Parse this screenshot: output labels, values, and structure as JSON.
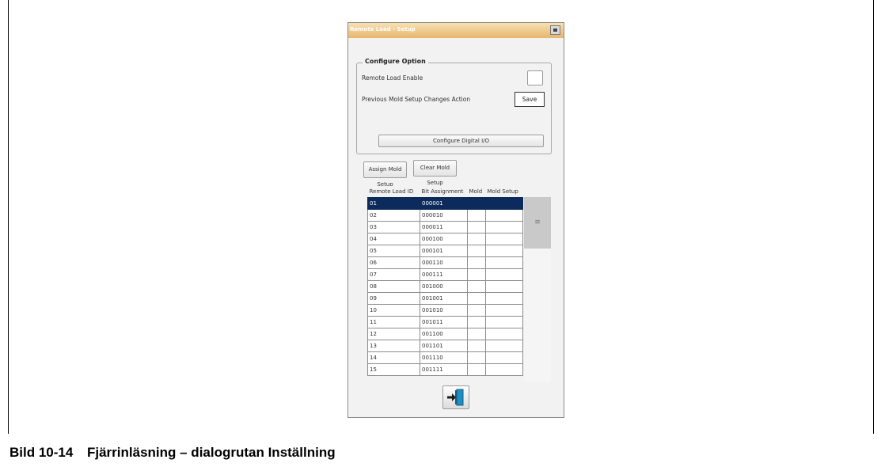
{
  "dialog": {
    "title": "Remote Load - Setup",
    "group_title": "Configure Option",
    "remote_load_enable_label": "Remote Load Enable",
    "previous_changes_label": "Previous Mold Setup Changes Action",
    "previous_changes_value": "Save",
    "configure_digital_io_label": "Configure Digital I/O",
    "assign_button_label": "Assign Mold Setup",
    "clear_button_label": "Clear Mold Setup",
    "exit_icon": "exit-door-icon",
    "table": {
      "headers": [
        "Remote Load ID",
        "Bit Assignment",
        "Mold",
        "Mold Setup"
      ],
      "rows": [
        [
          "01",
          "000001",
          "",
          ""
        ],
        [
          "02",
          "000010",
          "",
          ""
        ],
        [
          "03",
          "000011",
          "",
          ""
        ],
        [
          "04",
          "000100",
          "",
          ""
        ],
        [
          "05",
          "000101",
          "",
          ""
        ],
        [
          "06",
          "000110",
          "",
          ""
        ],
        [
          "07",
          "000111",
          "",
          ""
        ],
        [
          "08",
          "001000",
          "",
          ""
        ],
        [
          "09",
          "001001",
          "",
          ""
        ],
        [
          "10",
          "001010",
          "",
          ""
        ],
        [
          "11",
          "001011",
          "",
          ""
        ],
        [
          "12",
          "001100",
          "",
          ""
        ],
        [
          "13",
          "001101",
          "",
          ""
        ],
        [
          "14",
          "001110",
          "",
          ""
        ],
        [
          "15",
          "001111",
          "",
          ""
        ]
      ],
      "selected_row": 0
    }
  },
  "caption": {
    "number": "Bild 10-14",
    "text": "Fjärrinläsning – dialogrutan Inställning"
  },
  "colors": {
    "title_bar": "#e9b46d",
    "selection": "#0c2a5b",
    "exit_icon_blue": "#1e8fbf"
  }
}
